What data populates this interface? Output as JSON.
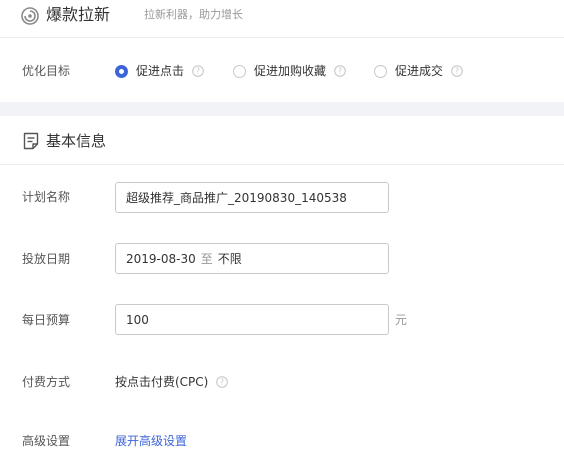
{
  "header": {
    "brand_icon": "target-swirl-icon",
    "title": "爆款拉新",
    "subtitle": "拉新利器，助力增长"
  },
  "optimization": {
    "label": "优化目标",
    "options": [
      {
        "label": "促进点击",
        "selected": true
      },
      {
        "label": "促进加购收藏",
        "selected": false
      },
      {
        "label": "促进成交",
        "selected": false
      }
    ],
    "help_icon": "question-circle-icon"
  },
  "basic_info": {
    "icon": "document-icon",
    "title": "基本信息",
    "plan_name": {
      "label": "计划名称",
      "value": "超级推荐_商品推广_20190830_140538"
    },
    "date": {
      "label": "投放日期",
      "start": "2019-08-30",
      "separator": "至",
      "end": "不限"
    },
    "budget": {
      "label": "每日预算",
      "value": "100",
      "unit": "元"
    },
    "payment": {
      "label": "付费方式",
      "value": "按点击付费(CPC)"
    },
    "advanced": {
      "label": "高级设置",
      "link": "展开高级设置"
    }
  },
  "colors": {
    "accent": "#3d64d8",
    "band": "#f2f3f7",
    "border": "#c9c9c9",
    "muted": "#999999"
  }
}
